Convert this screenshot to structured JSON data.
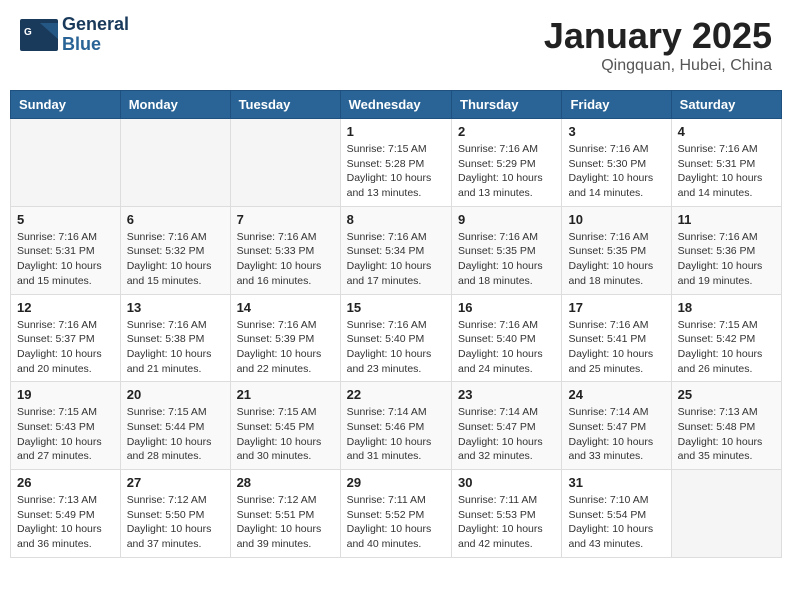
{
  "header": {
    "logo_line1": "General",
    "logo_line2": "Blue",
    "month_title": "January 2025",
    "location": "Qingquan, Hubei, China"
  },
  "weekdays": [
    "Sunday",
    "Monday",
    "Tuesday",
    "Wednesday",
    "Thursday",
    "Friday",
    "Saturday"
  ],
  "weeks": [
    [
      {
        "day": "",
        "info": ""
      },
      {
        "day": "",
        "info": ""
      },
      {
        "day": "",
        "info": ""
      },
      {
        "day": "1",
        "info": "Sunrise: 7:15 AM\nSunset: 5:28 PM\nDaylight: 10 hours\nand 13 minutes."
      },
      {
        "day": "2",
        "info": "Sunrise: 7:16 AM\nSunset: 5:29 PM\nDaylight: 10 hours\nand 13 minutes."
      },
      {
        "day": "3",
        "info": "Sunrise: 7:16 AM\nSunset: 5:30 PM\nDaylight: 10 hours\nand 14 minutes."
      },
      {
        "day": "4",
        "info": "Sunrise: 7:16 AM\nSunset: 5:31 PM\nDaylight: 10 hours\nand 14 minutes."
      }
    ],
    [
      {
        "day": "5",
        "info": "Sunrise: 7:16 AM\nSunset: 5:31 PM\nDaylight: 10 hours\nand 15 minutes."
      },
      {
        "day": "6",
        "info": "Sunrise: 7:16 AM\nSunset: 5:32 PM\nDaylight: 10 hours\nand 15 minutes."
      },
      {
        "day": "7",
        "info": "Sunrise: 7:16 AM\nSunset: 5:33 PM\nDaylight: 10 hours\nand 16 minutes."
      },
      {
        "day": "8",
        "info": "Sunrise: 7:16 AM\nSunset: 5:34 PM\nDaylight: 10 hours\nand 17 minutes."
      },
      {
        "day": "9",
        "info": "Sunrise: 7:16 AM\nSunset: 5:35 PM\nDaylight: 10 hours\nand 18 minutes."
      },
      {
        "day": "10",
        "info": "Sunrise: 7:16 AM\nSunset: 5:35 PM\nDaylight: 10 hours\nand 18 minutes."
      },
      {
        "day": "11",
        "info": "Sunrise: 7:16 AM\nSunset: 5:36 PM\nDaylight: 10 hours\nand 19 minutes."
      }
    ],
    [
      {
        "day": "12",
        "info": "Sunrise: 7:16 AM\nSunset: 5:37 PM\nDaylight: 10 hours\nand 20 minutes."
      },
      {
        "day": "13",
        "info": "Sunrise: 7:16 AM\nSunset: 5:38 PM\nDaylight: 10 hours\nand 21 minutes."
      },
      {
        "day": "14",
        "info": "Sunrise: 7:16 AM\nSunset: 5:39 PM\nDaylight: 10 hours\nand 22 minutes."
      },
      {
        "day": "15",
        "info": "Sunrise: 7:16 AM\nSunset: 5:40 PM\nDaylight: 10 hours\nand 23 minutes."
      },
      {
        "day": "16",
        "info": "Sunrise: 7:16 AM\nSunset: 5:40 PM\nDaylight: 10 hours\nand 24 minutes."
      },
      {
        "day": "17",
        "info": "Sunrise: 7:16 AM\nSunset: 5:41 PM\nDaylight: 10 hours\nand 25 minutes."
      },
      {
        "day": "18",
        "info": "Sunrise: 7:15 AM\nSunset: 5:42 PM\nDaylight: 10 hours\nand 26 minutes."
      }
    ],
    [
      {
        "day": "19",
        "info": "Sunrise: 7:15 AM\nSunset: 5:43 PM\nDaylight: 10 hours\nand 27 minutes."
      },
      {
        "day": "20",
        "info": "Sunrise: 7:15 AM\nSunset: 5:44 PM\nDaylight: 10 hours\nand 28 minutes."
      },
      {
        "day": "21",
        "info": "Sunrise: 7:15 AM\nSunset: 5:45 PM\nDaylight: 10 hours\nand 30 minutes."
      },
      {
        "day": "22",
        "info": "Sunrise: 7:14 AM\nSunset: 5:46 PM\nDaylight: 10 hours\nand 31 minutes."
      },
      {
        "day": "23",
        "info": "Sunrise: 7:14 AM\nSunset: 5:47 PM\nDaylight: 10 hours\nand 32 minutes."
      },
      {
        "day": "24",
        "info": "Sunrise: 7:14 AM\nSunset: 5:47 PM\nDaylight: 10 hours\nand 33 minutes."
      },
      {
        "day": "25",
        "info": "Sunrise: 7:13 AM\nSunset: 5:48 PM\nDaylight: 10 hours\nand 35 minutes."
      }
    ],
    [
      {
        "day": "26",
        "info": "Sunrise: 7:13 AM\nSunset: 5:49 PM\nDaylight: 10 hours\nand 36 minutes."
      },
      {
        "day": "27",
        "info": "Sunrise: 7:12 AM\nSunset: 5:50 PM\nDaylight: 10 hours\nand 37 minutes."
      },
      {
        "day": "28",
        "info": "Sunrise: 7:12 AM\nSunset: 5:51 PM\nDaylight: 10 hours\nand 39 minutes."
      },
      {
        "day": "29",
        "info": "Sunrise: 7:11 AM\nSunset: 5:52 PM\nDaylight: 10 hours\nand 40 minutes."
      },
      {
        "day": "30",
        "info": "Sunrise: 7:11 AM\nSunset: 5:53 PM\nDaylight: 10 hours\nand 42 minutes."
      },
      {
        "day": "31",
        "info": "Sunrise: 7:10 AM\nSunset: 5:54 PM\nDaylight: 10 hours\nand 43 minutes."
      },
      {
        "day": "",
        "info": ""
      }
    ]
  ]
}
